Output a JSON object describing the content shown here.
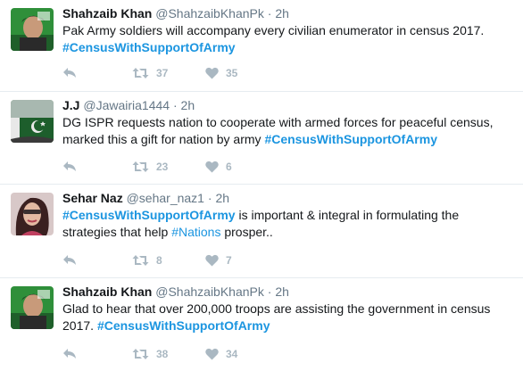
{
  "tweets": [
    {
      "name": "Shahzaib Khan",
      "handle": "@ShahzaibKhanPk",
      "sep": "·",
      "time": "2h",
      "line1": "Pak Army soldiers will accompany every civilian enumerator in census 2017.",
      "hashtag": "#CensusWithSupportOfArmy",
      "retweets": "37",
      "likes": "35"
    },
    {
      "name": "J.J",
      "handle": "@Jawairia1444",
      "sep": "·",
      "time": "2h",
      "line1": "DG ISPR requests nation to cooperate with armed forces for peaceful census,",
      "line2": "marked this a gift for nation by army ",
      "hashtag": "#CensusWithSupportOfArmy",
      "retweets": "23",
      "likes": "6"
    },
    {
      "name": "Sehar Naz",
      "handle": "@sehar_naz1",
      "sep": "·",
      "time": "2h",
      "hashtag": "#CensusWithSupportOfArmy",
      "line1_rest": " is important & integral in formulating the",
      "line2_a": "strategies that help ",
      "hashtag2": "#Nations",
      "line2_b": " prosper..",
      "retweets": "8",
      "likes": "7"
    },
    {
      "name": "Shahzaib Khan",
      "handle": "@ShahzaibKhanPk",
      "sep": "·",
      "time": "2h",
      "line1": "Glad to hear that over 200,000 troops are assisting the government in census",
      "line2": "2017. ",
      "hashtag": "#CensusWithSupportOfArmy",
      "retweets": "38",
      "likes": "34"
    }
  ],
  "colors": {
    "link": "#1b95e0",
    "muted": "#657786",
    "action": "#aab8c2",
    "divider": "#e6ecf0"
  },
  "icons": [
    "reply-icon",
    "retweet-icon",
    "heart-icon"
  ]
}
